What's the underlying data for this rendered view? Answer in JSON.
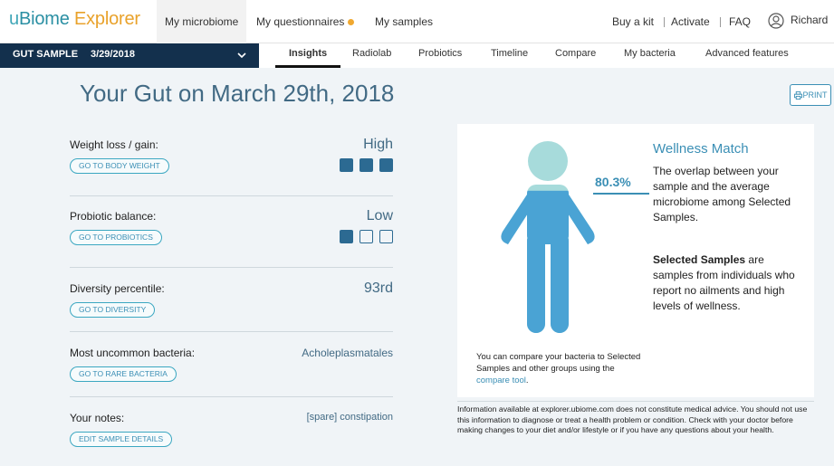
{
  "brand": {
    "part1": "u",
    "part2": "Biome",
    "part3": " Explorer"
  },
  "topnav": {
    "tabs": [
      {
        "label": "My microbiome"
      },
      {
        "label": "My questionnaires"
      },
      {
        "label": "My samples"
      }
    ],
    "links": [
      {
        "label": "Buy a kit"
      },
      {
        "label": "Activate"
      },
      {
        "label": "FAQ"
      }
    ],
    "user": "Richard"
  },
  "sample": {
    "name": "GUT SAMPLE",
    "date": "3/29/2018"
  },
  "subnav": {
    "tabs": [
      {
        "label": "Insights"
      },
      {
        "label": "Radiolab"
      },
      {
        "label": "Probiotics"
      },
      {
        "label": "Timeline"
      },
      {
        "label": "Compare"
      },
      {
        "label": "My bacteria"
      },
      {
        "label": "Advanced features"
      }
    ]
  },
  "page": {
    "title": "Your Gut on March 29th, 2018",
    "print_label": "PRINT"
  },
  "metrics": [
    {
      "label": "Weight loss / gain:",
      "button": "GO TO BODY WEIGHT",
      "value": "High",
      "level": 3,
      "max": 3
    },
    {
      "label": "Probiotic balance:",
      "button": "GO TO PROBIOTICS",
      "value": "Low",
      "level": 1,
      "max": 3
    },
    {
      "label": "Diversity percentile:",
      "button": "GO TO DIVERSITY",
      "value": "93rd"
    },
    {
      "label": "Most uncommon bacteria:",
      "button": "GO TO RARE BACTERIA",
      "value": "Acholeplasmatales"
    },
    {
      "label": "Your notes:",
      "button": "EDIT SAMPLE DETAILS",
      "value": "[spare] constipation"
    }
  ],
  "wellness": {
    "match_pct": "80.3%",
    "match_fraction": 0.803,
    "title": "Wellness Match",
    "description": "The overlap between your sample and the average microbiome among Selected Samples.",
    "selected_bold": "Selected Samples",
    "selected_text": " are samples from individuals who report no ailments and high levels of wellness.",
    "compare_note": "You can compare your bacteria to Selected Samples and other groups using the ",
    "compare_link": "compare tool",
    "compare_end": "."
  },
  "disclaimer": "Information available at explorer.ubiome.com does not constitute medical advice. You should not use this information to diagnose or treat a health problem or condition. Check with your doctor before making changes to your diet and/or lifestyle or if you have any questions about your health.",
  "colors": {
    "brand_teal": "#2a8fa3",
    "brand_orange": "#e9a22b",
    "navy": "#13304d",
    "accent_blue": "#3b8fb5",
    "figure_full": "#4aa3d4",
    "figure_empty": "#a7dbdb"
  }
}
